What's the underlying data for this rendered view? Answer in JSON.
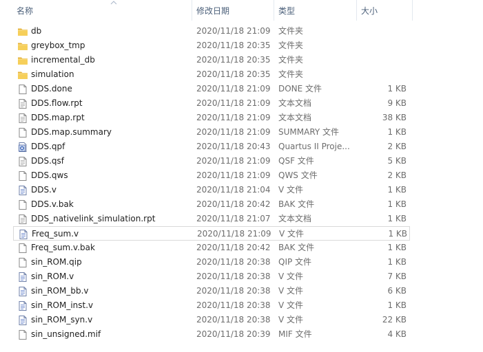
{
  "columns": {
    "name": "名称",
    "modified": "修改日期",
    "type": "类型",
    "size": "大小"
  },
  "files": [
    {
      "name": "db",
      "date": "2020/11/18 21:09",
      "type": "文件夹",
      "size": "",
      "icon": "folder-icon",
      "selected": false
    },
    {
      "name": "greybox_tmp",
      "date": "2020/11/18 20:35",
      "type": "文件夹",
      "size": "",
      "icon": "folder-icon",
      "selected": false
    },
    {
      "name": "incremental_db",
      "date": "2020/11/18 20:35",
      "type": "文件夹",
      "size": "",
      "icon": "folder-icon",
      "selected": false
    },
    {
      "name": "simulation",
      "date": "2020/11/18 20:35",
      "type": "文件夹",
      "size": "",
      "icon": "folder-icon",
      "selected": false
    },
    {
      "name": "DDS.done",
      "date": "2020/11/18 21:09",
      "type": "DONE 文件",
      "size": "1 KB",
      "icon": "blank-file-icon",
      "selected": false
    },
    {
      "name": "DDS.flow.rpt",
      "date": "2020/11/18 21:09",
      "type": "文本文档",
      "size": "9 KB",
      "icon": "text-file-icon",
      "selected": false
    },
    {
      "name": "DDS.map.rpt",
      "date": "2020/11/18 21:09",
      "type": "文本文档",
      "size": "38 KB",
      "icon": "text-file-icon",
      "selected": false
    },
    {
      "name": "DDS.map.summary",
      "date": "2020/11/18 21:09",
      "type": "SUMMARY 文件",
      "size": "1 KB",
      "icon": "blank-file-icon",
      "selected": false
    },
    {
      "name": "DDS.qpf",
      "date": "2020/11/18 20:43",
      "type": "Quartus II Proje...",
      "size": "2 KB",
      "icon": "quartus-project-icon",
      "selected": false
    },
    {
      "name": "DDS.qsf",
      "date": "2020/11/18 21:09",
      "type": "QSF 文件",
      "size": "5 KB",
      "icon": "text-file-icon",
      "selected": false
    },
    {
      "name": "DDS.qws",
      "date": "2020/11/18 21:09",
      "type": "QWS 文件",
      "size": "2 KB",
      "icon": "blank-file-icon",
      "selected": false
    },
    {
      "name": "DDS.v",
      "date": "2020/11/18 21:04",
      "type": "V 文件",
      "size": "1 KB",
      "icon": "code-file-icon",
      "selected": false
    },
    {
      "name": "DDS.v.bak",
      "date": "2020/11/18 20:42",
      "type": "BAK 文件",
      "size": "1 KB",
      "icon": "blank-file-icon",
      "selected": false
    },
    {
      "name": "DDS_nativelink_simulation.rpt",
      "date": "2020/11/18 21:07",
      "type": "文本文档",
      "size": "1 KB",
      "icon": "text-file-icon",
      "selected": false
    },
    {
      "name": "Freq_sum.v",
      "date": "2020/11/18 21:09",
      "type": "V 文件",
      "size": "1 KB",
      "icon": "code-file-icon",
      "selected": true
    },
    {
      "name": "Freq_sum.v.bak",
      "date": "2020/11/18 20:42",
      "type": "BAK 文件",
      "size": "1 KB",
      "icon": "blank-file-icon",
      "selected": false
    },
    {
      "name": "sin_ROM.qip",
      "date": "2020/11/18 20:38",
      "type": "QIP 文件",
      "size": "1 KB",
      "icon": "blank-file-icon",
      "selected": false
    },
    {
      "name": "sin_ROM.v",
      "date": "2020/11/18 20:38",
      "type": "V 文件",
      "size": "7 KB",
      "icon": "code-file-icon",
      "selected": false
    },
    {
      "name": "sin_ROM_bb.v",
      "date": "2020/11/18 20:38",
      "type": "V 文件",
      "size": "6 KB",
      "icon": "code-file-icon",
      "selected": false
    },
    {
      "name": "sin_ROM_inst.v",
      "date": "2020/11/18 20:38",
      "type": "V 文件",
      "size": "1 KB",
      "icon": "code-file-icon",
      "selected": false
    },
    {
      "name": "sin_ROM_syn.v",
      "date": "2020/11/18 20:38",
      "type": "V 文件",
      "size": "22 KB",
      "icon": "code-file-icon",
      "selected": false
    },
    {
      "name": "sin_unsigned.mif",
      "date": "2020/11/18 20:39",
      "type": "MIF 文件",
      "size": "4 KB",
      "icon": "blank-file-icon",
      "selected": false
    }
  ],
  "colors": {
    "header_text": "#4c607a",
    "folder": "#f3c74b",
    "selected_border": "#d9d9d9"
  }
}
